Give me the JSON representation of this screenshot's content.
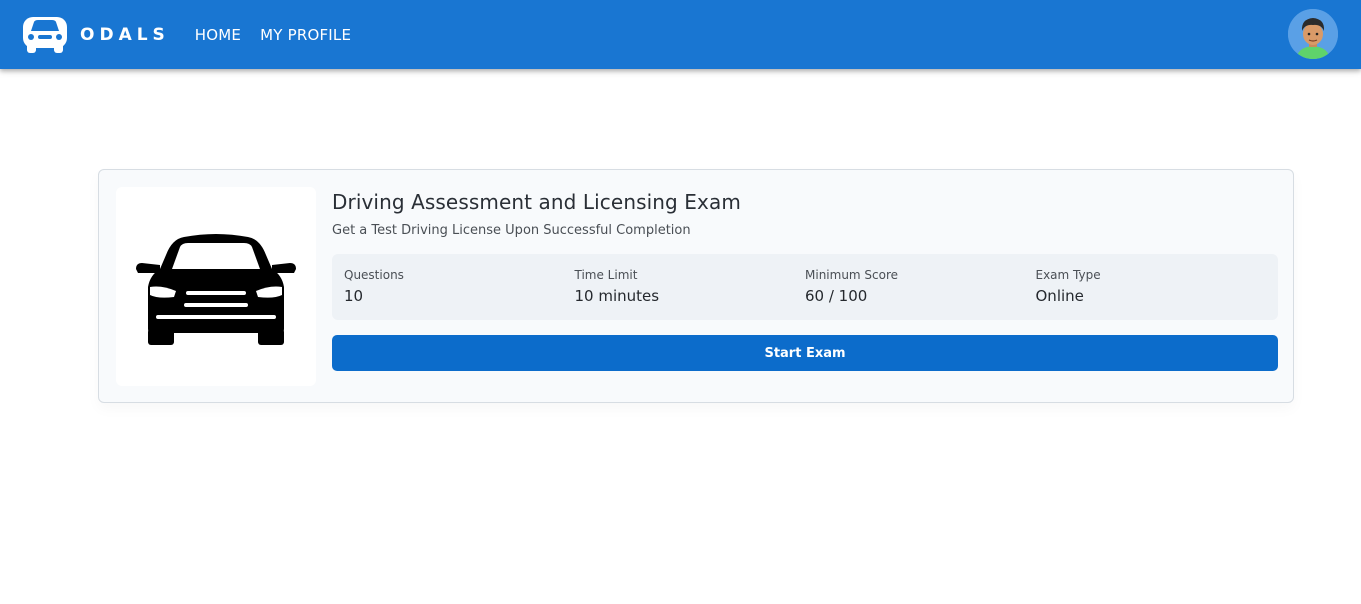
{
  "header": {
    "brand": "ODALS",
    "logo_icon": "car-icon",
    "nav": [
      {
        "label": "HOME"
      },
      {
        "label": "MY PROFILE"
      }
    ],
    "avatar_icon": "user-avatar",
    "background_color": "#1976d2"
  },
  "exam_card": {
    "image_icon": "car-front-icon",
    "title": "Driving Assessment and Licensing Exam",
    "subtitle": "Get a Test Driving License Upon Successful Completion",
    "stats": [
      {
        "label": "Questions",
        "value": "10"
      },
      {
        "label": "Time Limit",
        "value": "10 minutes"
      },
      {
        "label": "Minimum Score",
        "value": "60 / 100"
      },
      {
        "label": "Exam Type",
        "value": "Online"
      }
    ],
    "start_button": "Start Exam",
    "button_color": "#0c6ccb"
  }
}
